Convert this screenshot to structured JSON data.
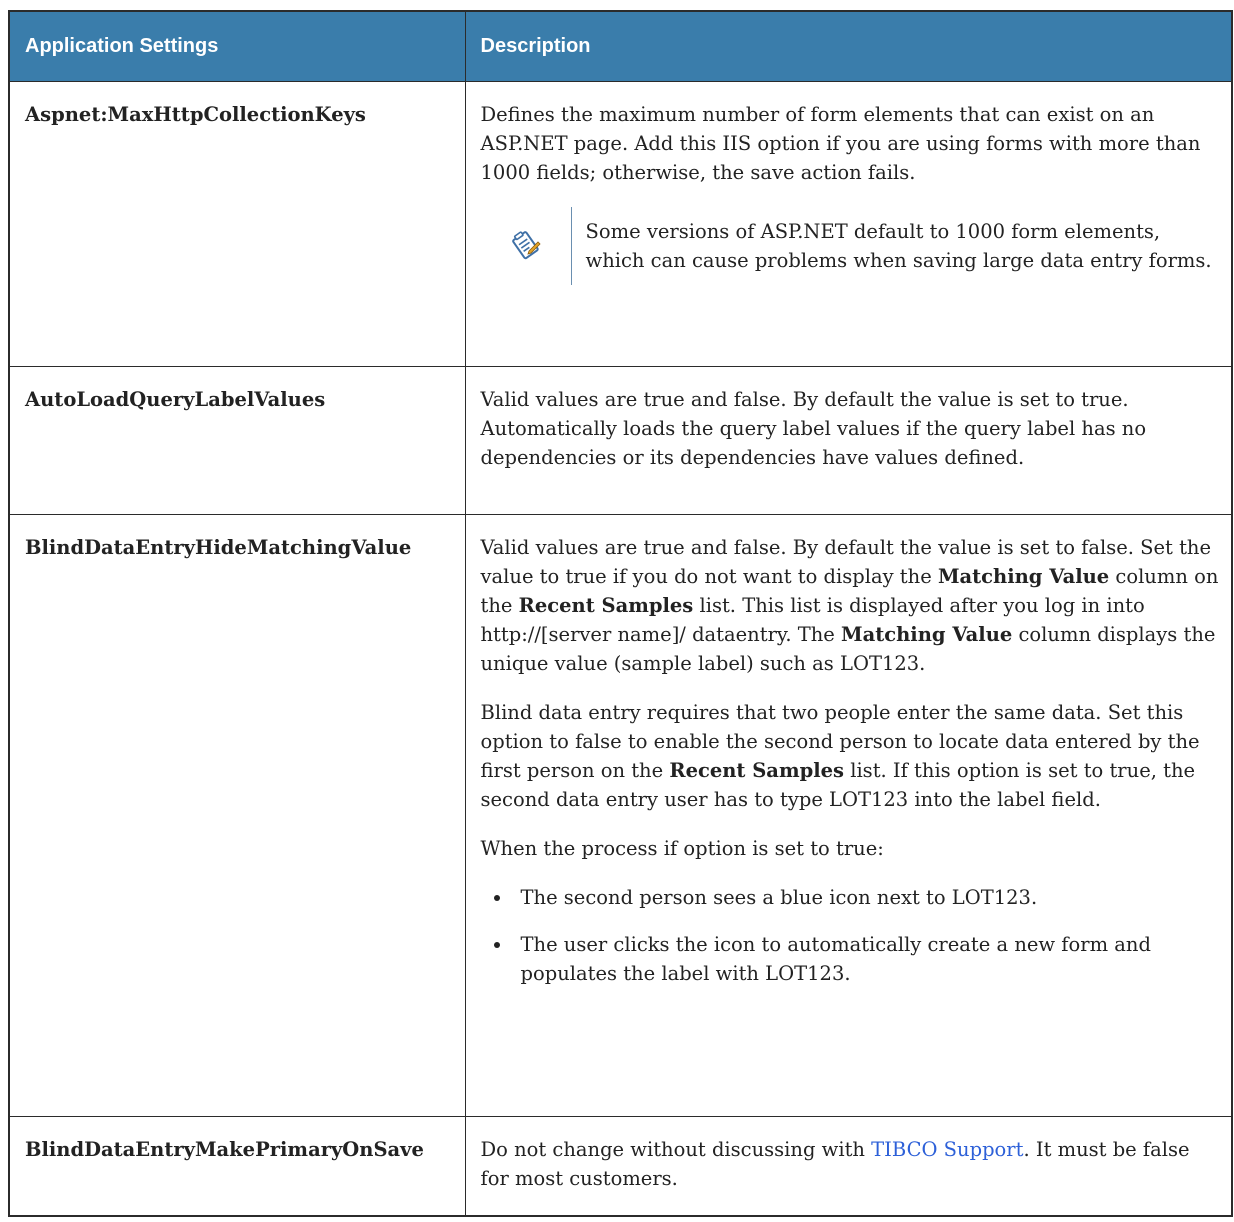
{
  "table": {
    "headers": [
      "Application Settings",
      "Description"
    ],
    "rows": [
      {
        "name": "Aspnet:MaxHttpCollectionKeys",
        "paragraphs": [
          "Defines the maximum number of form elements that can exist on an ASP.NET page. Add this IIS option if you are using forms with more than 1000 fields; otherwise, the save action fails."
        ],
        "note": "Some versions of ASP.NET default to 1000 form elements, which can cause problems when saving large data entry forms."
      },
      {
        "name": "AutoLoadQueryLabelValues",
        "paragraphs": [
          "Valid values are true and false. By default the value is set to true. Automatically loads the query label values if the query label has no dependencies or its dependencies have values defined."
        ]
      },
      {
        "name": "BlindDataEntryHideMatchingValue",
        "p1": {
          "t1": "Valid values are true and false. By default the value is set to false. Set the value to true if you do not want to display the ",
          "b1": "Matching Value",
          "t2": " column on the ",
          "b2": "Recent Samples",
          "t3": " list. This list is displayed after you log in into http://[server name]/ dataentry. The ",
          "b3": "Matching Value",
          "t4": " column displays the unique value (sample label) such as LOT123."
        },
        "p2": {
          "t1": "Blind data entry requires that two people enter the same data. Set this option to false to enable the second person to locate data entered by the first person on the ",
          "b1": "Recent Samples",
          "t2": " list. If this option is set to true, the second data entry user has to type LOT123 into the label field."
        },
        "p3": "When the process if option is set to true:",
        "bullets": [
          "The second person sees a blue icon next to LOT123.",
          "The user clicks the icon to automatically create a new form and populates the label with LOT123."
        ]
      },
      {
        "name": "BlindDataEntryMakePrimaryOnSave",
        "t1": "Do not change without discussing with ",
        "link": "TIBCO Support",
        "t2": ". It must be false for most customers."
      }
    ]
  },
  "icons": {
    "note": "note-pencil-icon"
  },
  "colors": {
    "header_bg": "#3a7dab",
    "link": "#2d60d8"
  }
}
